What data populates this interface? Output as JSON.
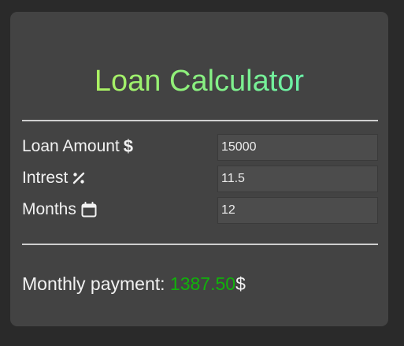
{
  "calculator": {
    "title": "Loan Calculator",
    "fields": [
      {
        "label": "Loan Amount",
        "icon": "dollar-icon",
        "value": "15000"
      },
      {
        "label": "Intrest",
        "icon": "percent-icon",
        "value": "11.5"
      },
      {
        "label": "Months",
        "icon": "calendar-icon",
        "value": "12"
      }
    ],
    "result": {
      "label": "Monthly payment: ",
      "value": "1387.50",
      "currency": "$"
    },
    "icons": {
      "dollar": "$"
    },
    "colors": {
      "result_value": "#10b30a",
      "title_gradient_start": "#c9f24a",
      "title_gradient_end": "#4ff0c6"
    }
  }
}
